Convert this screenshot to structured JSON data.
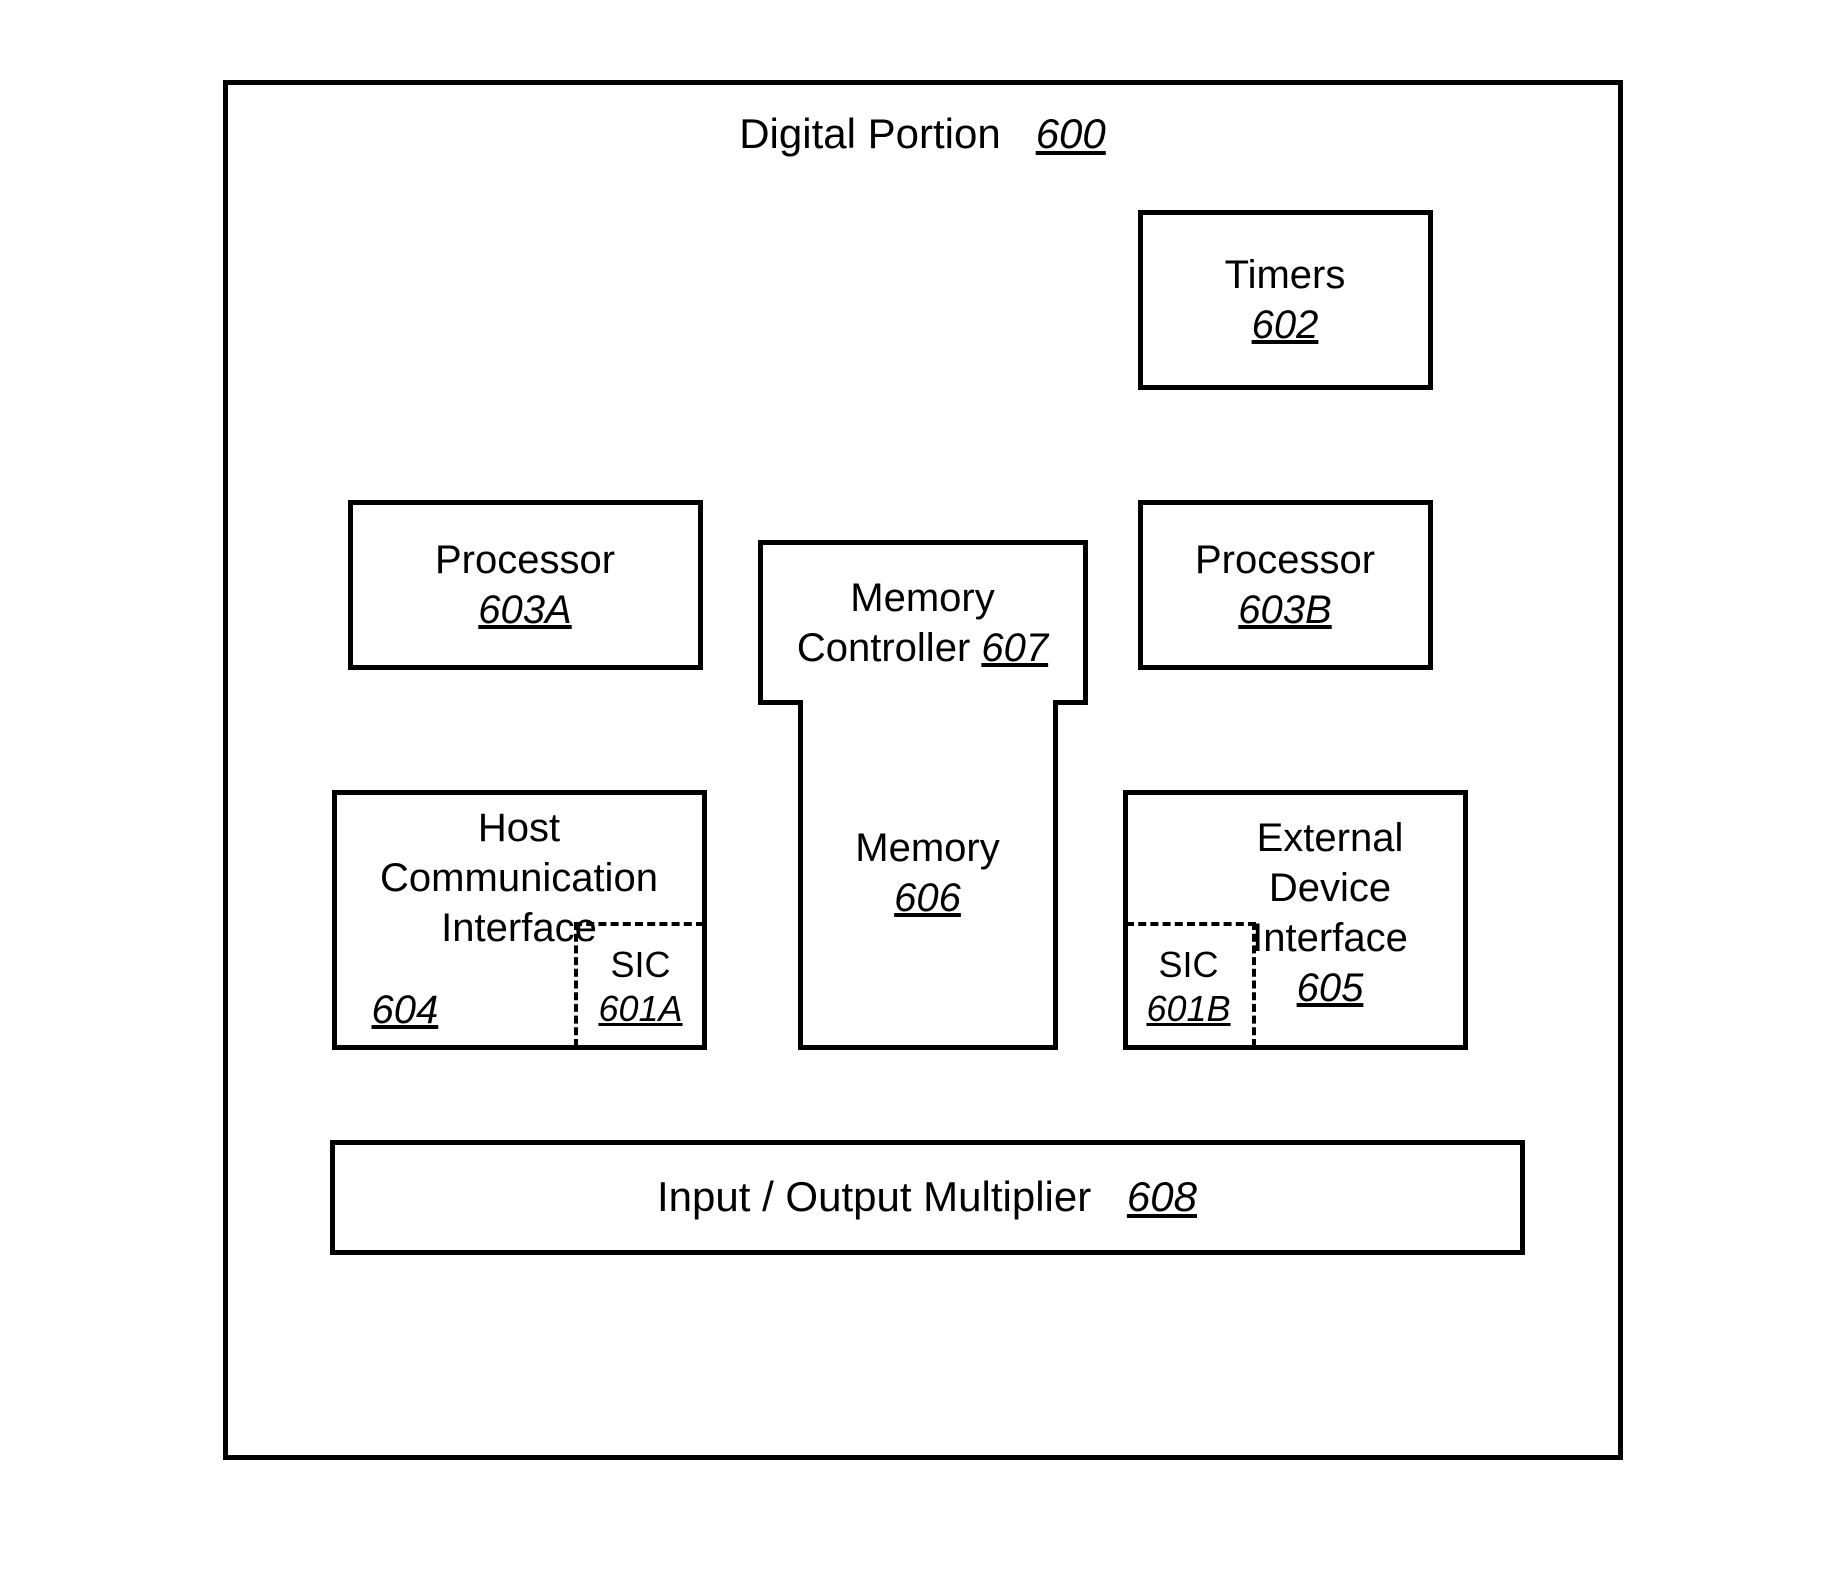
{
  "diagram": {
    "title": {
      "label": "Digital Portion",
      "ref": "600"
    },
    "timers": {
      "label": "Timers",
      "ref": "602"
    },
    "processor_a": {
      "label": "Processor",
      "ref": "603A"
    },
    "processor_b": {
      "label": "Processor",
      "ref": "603B"
    },
    "memory_controller": {
      "label": "Memory",
      "label2": "Controller",
      "ref": "607"
    },
    "memory": {
      "label": "Memory",
      "ref": "606"
    },
    "host_comm": {
      "line1": "Host",
      "line2": "Communication",
      "line3": "Interface",
      "ref": "604"
    },
    "sic_a": {
      "label": "SIC",
      "ref": "601A"
    },
    "external_device": {
      "line1": "External Device",
      "line2": "Interface",
      "ref": "605"
    },
    "sic_b": {
      "label": "SIC",
      "ref": "601B"
    },
    "io_multiplier": {
      "label": "Input / Output Multiplier",
      "ref": "608"
    }
  }
}
